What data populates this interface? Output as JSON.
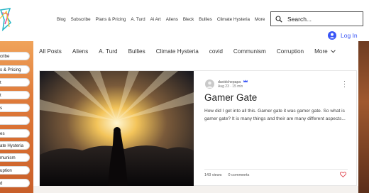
{
  "header": {
    "nav": [
      "Blog",
      "Subscribe",
      "Plans & Pricing",
      "A. Turd",
      "Ai Art",
      "Aliens",
      "Bleck",
      "Bullies",
      "Climate Hysteria",
      "More"
    ],
    "search_placeholder": "Search...",
    "login_label": "Log In"
  },
  "sidebar": {
    "items": [
      "cribe",
      "s & Pricing",
      "t",
      "t",
      "s",
      "",
      "es",
      "ate Hysteria",
      "munism",
      "uption",
      "d"
    ]
  },
  "categories": {
    "items": [
      "All Posts",
      "Aliens",
      "A. Turd",
      "Bullies",
      "Climate Hysteria",
      "covid",
      "Communism",
      "Corruption"
    ],
    "more_label": "More"
  },
  "post": {
    "author": "davidchepapa",
    "date": "Aug 23  ·  15 min",
    "title": "Gamer Gate",
    "excerpt": "How did I get into all this. Gamer gate it was gamer gate. So what is gamer gate? It is many things and their are many different aspects...",
    "views": "143 views",
    "comments": "0 comments"
  },
  "colors": {
    "accent": "#3955f6",
    "heart": "#e0414b",
    "sidebar_orange": "#e07d3c"
  }
}
